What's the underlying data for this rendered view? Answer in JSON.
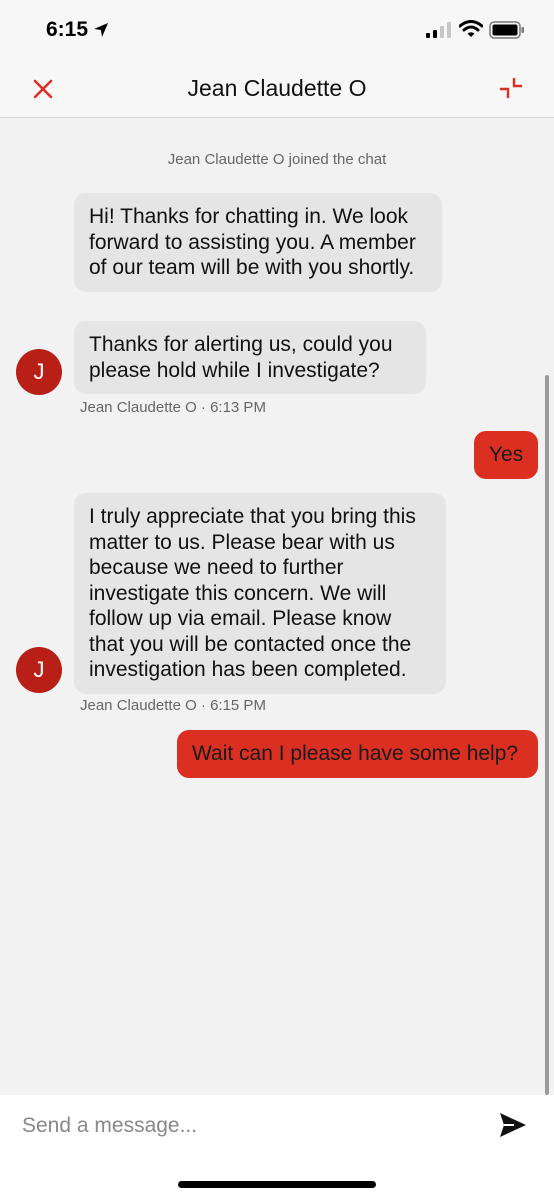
{
  "status_bar": {
    "time": "6:15"
  },
  "header": {
    "title": "Jean Claudette O"
  },
  "chat": {
    "system_message": "Jean Claudette O joined the chat",
    "messages": [
      {
        "sender": "agent",
        "text": "Hi! Thanks for chatting in. We look forward to assisting you. A member of our team will be with you shortly."
      },
      {
        "sender": "agent",
        "text": "Thanks for alerting us, could you please hold while I investigate?"
      },
      {
        "sender": "user",
        "text": "Yes"
      },
      {
        "sender": "agent",
        "text": "I truly appreciate that you bring this matter to us. Please bear with us because we need to further investigate this concern. We will follow up via email. Please know that you will be contacted once the investigation has been completed."
      },
      {
        "sender": "user",
        "text": "Wait can I please have some help?"
      }
    ],
    "groups": [
      {
        "avatar_initial": "J",
        "meta": "Jean Claudette O · 6:13 PM"
      },
      {
        "avatar_initial": "J",
        "meta": "Jean Claudette O · 6:15 PM"
      }
    ]
  },
  "composer": {
    "placeholder": "Send a message...",
    "value": ""
  },
  "icons": {
    "close": "close-icon",
    "minimize": "minimize-icon",
    "send": "send-icon",
    "location": "location-arrow-icon",
    "signal": "cellular-signal-icon",
    "wifi": "wifi-icon",
    "battery": "battery-icon"
  },
  "colors": {
    "accent": "#db2f22",
    "avatar": "#b81f16",
    "agent_bubble": "#e5e5e5",
    "background": "#f2f2f2"
  }
}
